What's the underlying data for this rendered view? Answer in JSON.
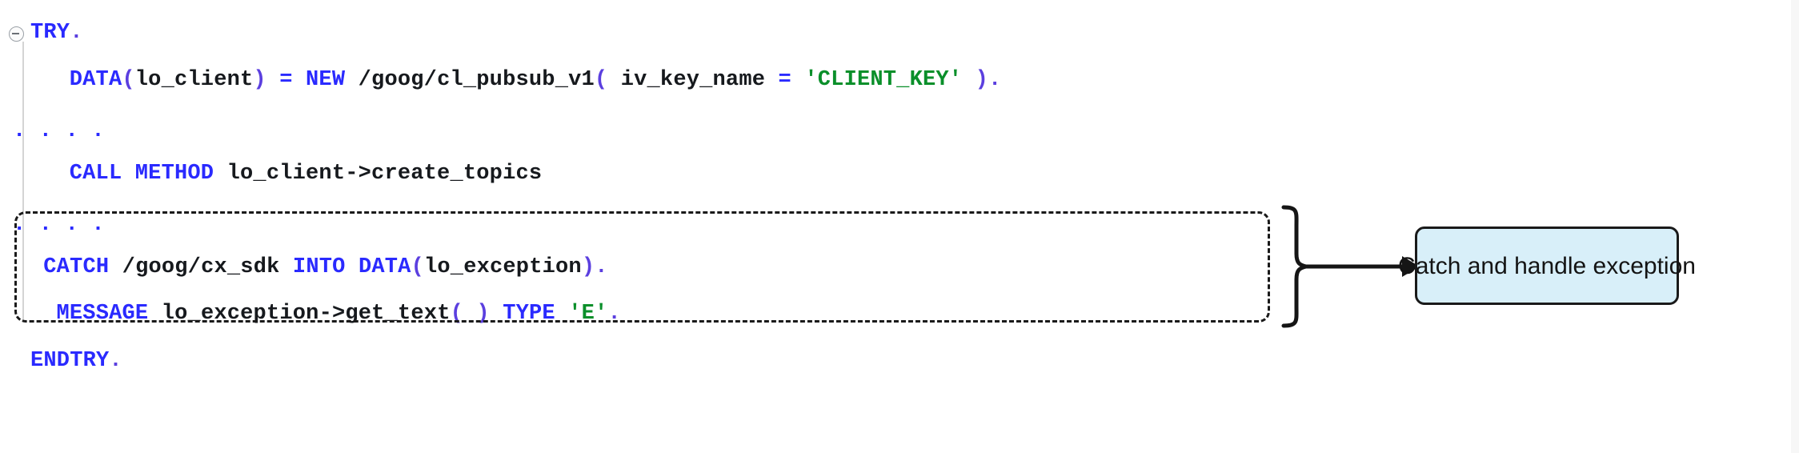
{
  "editor": {
    "language": "ABAP",
    "fold_icon": "collapse-minus-icon",
    "gutter_color": "#d4d4d4",
    "continuation_marker": ". . . .",
    "lines": [
      {
        "id": "line-try",
        "indent": 0,
        "tokens": [
          {
            "text": "TRY",
            "kind": "kw"
          },
          {
            "text": ".",
            "kind": "pnc"
          }
        ],
        "plain": "TRY."
      },
      {
        "id": "line-data-new-client",
        "indent": 3,
        "tokens": [
          {
            "text": "DATA",
            "kind": "kw"
          },
          {
            "text": "(",
            "kind": "pnc"
          },
          {
            "text": "lo_client",
            "kind": "id"
          },
          {
            "text": ")",
            "kind": "pnc"
          },
          {
            "text": " ",
            "kind": "id"
          },
          {
            "text": "=",
            "kind": "kw"
          },
          {
            "text": " ",
            "kind": "id"
          },
          {
            "text": "NEW",
            "kind": "kw"
          },
          {
            "text": " ",
            "kind": "id"
          },
          {
            "text": "/goog/cl_pubsub_v1",
            "kind": "path"
          },
          {
            "text": "(",
            "kind": "pnc"
          },
          {
            "text": " iv_key_name ",
            "kind": "id"
          },
          {
            "text": "=",
            "kind": "kw"
          },
          {
            "text": " ",
            "kind": "id"
          },
          {
            "text": "'CLIENT_KEY'",
            "kind": "str"
          },
          {
            "text": " ",
            "kind": "id"
          },
          {
            "text": ")",
            "kind": "pnc"
          },
          {
            "text": ".",
            "kind": "pnc"
          }
        ],
        "plain": "DATA(lo_client) = NEW /goog/cl_pubsub_v1( iv_key_name = 'CLIENT_KEY' )."
      },
      {
        "id": "line-continuation-1",
        "indent": 0,
        "continuation": true,
        "plain": ". . . ."
      },
      {
        "id": "line-call-method",
        "indent": 3,
        "tokens": [
          {
            "text": "CALL",
            "kind": "kw"
          },
          {
            "text": " ",
            "kind": "id"
          },
          {
            "text": "METHOD",
            "kind": "kw"
          },
          {
            "text": " ",
            "kind": "id"
          },
          {
            "text": "lo_client->create_topics",
            "kind": "id"
          }
        ],
        "plain": "CALL METHOD lo_client->create_topics"
      },
      {
        "id": "line-continuation-2",
        "indent": 0,
        "continuation": true,
        "plain": ". . . ."
      },
      {
        "id": "line-catch",
        "indent": 1,
        "tokens": [
          {
            "text": "CATCH",
            "kind": "kw"
          },
          {
            "text": " ",
            "kind": "id"
          },
          {
            "text": "/goog/cx_sdk",
            "kind": "path"
          },
          {
            "text": " ",
            "kind": "id"
          },
          {
            "text": "INTO",
            "kind": "kw"
          },
          {
            "text": " ",
            "kind": "id"
          },
          {
            "text": "DATA",
            "kind": "kw"
          },
          {
            "text": "(",
            "kind": "pnc"
          },
          {
            "text": "lo_exception",
            "kind": "id"
          },
          {
            "text": ")",
            "kind": "pnc"
          },
          {
            "text": ".",
            "kind": "pnc"
          }
        ],
        "plain": "CATCH /goog/cx_sdk INTO DATA(lo_exception)."
      },
      {
        "id": "line-message",
        "indent": 2,
        "tokens": [
          {
            "text": "MESSAGE",
            "kind": "kw"
          },
          {
            "text": " ",
            "kind": "id"
          },
          {
            "text": "lo_exception->get_text",
            "kind": "id"
          },
          {
            "text": "(",
            "kind": "pnc"
          },
          {
            "text": " ",
            "kind": "id"
          },
          {
            "text": ")",
            "kind": "pnc"
          },
          {
            "text": " ",
            "kind": "id"
          },
          {
            "text": "TYPE",
            "kind": "kw"
          },
          {
            "text": " ",
            "kind": "id"
          },
          {
            "text": "'E'",
            "kind": "str"
          },
          {
            "text": ".",
            "kind": "pnc"
          }
        ],
        "plain": "MESSAGE lo_exception->get_text( ) TYPE 'E'."
      },
      {
        "id": "line-endtry",
        "indent": 0,
        "tokens": [
          {
            "text": "ENDTRY",
            "kind": "kw"
          },
          {
            "text": ".",
            "kind": "pnc"
          }
        ],
        "plain": "ENDTRY."
      }
    ]
  },
  "annotation": {
    "highlight_region_name": "catch-block-highlight",
    "brace_name": "curly-brace-grouping",
    "arrow_name": "annotation-arrow",
    "callout_text": "Catch and handle exception",
    "callout_fill": "#d8eff9",
    "callout_border": "#1a1a1a",
    "dashed_border_color": "#1a1a1a"
  },
  "palette": {
    "keyword": "#2a2aff",
    "identifier": "#16191d",
    "string": "#0a8f2a",
    "punctuation": "#5b3fdf",
    "background": "#ffffff"
  }
}
